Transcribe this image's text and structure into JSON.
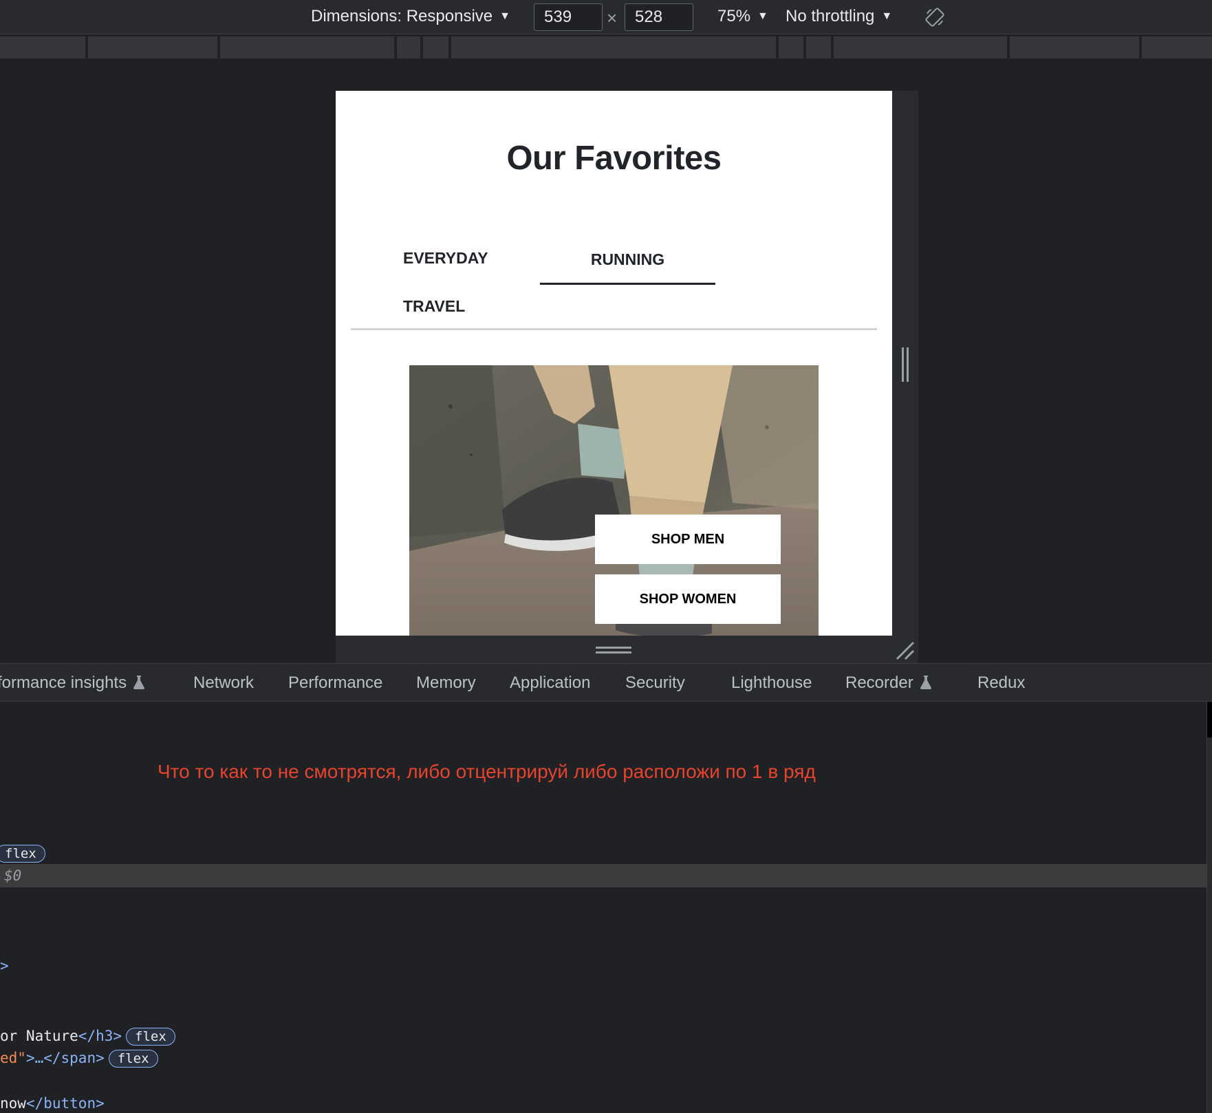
{
  "toolbar": {
    "dimensions_label": "Dimensions: Responsive",
    "width_value": "539",
    "height_value": "528",
    "times_symbol": "×",
    "zoom_label": "75%",
    "throttling_label": "No throttling",
    "caret": "▼"
  },
  "page": {
    "title": "Our Favorites",
    "tabs": [
      {
        "label": "EVERYDAY",
        "active": false
      },
      {
        "label": "RUNNING",
        "active": true
      },
      {
        "label": "TRAVEL",
        "active": false
      }
    ],
    "shop_men_label": "SHOP MEN",
    "shop_women_label": "SHOP WOMEN"
  },
  "devtools": {
    "tabs": [
      {
        "label": "formance insights",
        "experimental": true
      },
      {
        "label": "Network"
      },
      {
        "label": "Performance"
      },
      {
        "label": "Memory"
      },
      {
        "label": "Application"
      },
      {
        "label": "Security"
      },
      {
        "label": "Lighthouse"
      },
      {
        "label": "Recorder",
        "experimental": true
      },
      {
        "label": "Redux"
      }
    ],
    "annotation": "Что то как то не смотрятся, либо отцентрируй либо расположи по 1 в ряд",
    "code": {
      "flex_badge": "flex",
      "selected_ref": "$0",
      "line_close": ">",
      "h3_text": "or Nature",
      "h3_close": "</h3>",
      "span_attr_tail": "ed\"",
      "span_content": ">…",
      "span_close": "</span>",
      "button_text": "now",
      "button_close": "</button>"
    }
  },
  "colors": {
    "annotation": "#e8432b",
    "accent_tag": "#8ab4f8",
    "attr_value": "#f28b54"
  }
}
